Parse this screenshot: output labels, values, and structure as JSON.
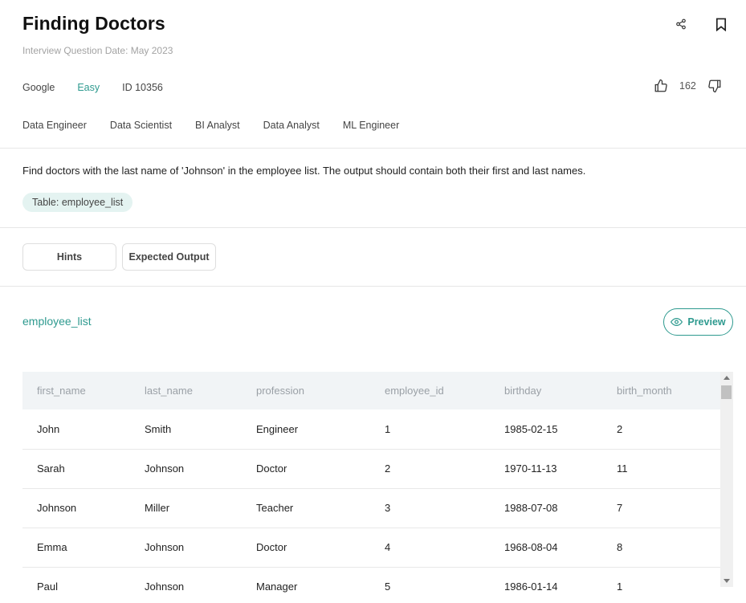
{
  "question": {
    "title": "Finding Doctors",
    "date": "Interview Question Date: May 2023",
    "company": "Google",
    "difficulty": "Easy",
    "id": "ID 10356",
    "votes": "162",
    "roles": [
      "Data Engineer",
      "Data Scientist",
      "BI Analyst",
      "Data Analyst",
      "ML Engineer"
    ],
    "description": "Find doctors with the last name of 'Johnson' in the employee list. The output should contain both their first and last names.",
    "table_chip": "Table: employee_list"
  },
  "tabs": {
    "hints": "Hints",
    "expected": "Expected Output"
  },
  "table": {
    "name": "employee_list",
    "preview_label": "Preview",
    "columns": [
      "first_name",
      "last_name",
      "profession",
      "employee_id",
      "birthday",
      "birth_month"
    ],
    "rows": [
      [
        "John",
        "Smith",
        "Engineer",
        "1",
        "1985-02-15",
        "2"
      ],
      [
        "Sarah",
        "Johnson",
        "Doctor",
        "2",
        "1970-11-13",
        "11"
      ],
      [
        "Johnson",
        "Miller",
        "Teacher",
        "3",
        "1988-07-08",
        "7"
      ],
      [
        "Emma",
        "Johnson",
        "Doctor",
        "4",
        "1968-08-04",
        "8"
      ],
      [
        "Paul",
        "Johnson",
        "Manager",
        "5",
        "1986-01-14",
        "1"
      ]
    ]
  },
  "colors": {
    "accent": "#2e9a8f",
    "chip_bg": "#e4f3f1",
    "header_bg": "#f1f4f6"
  },
  "icons": [
    "share-icon",
    "bookmark-icon",
    "thumbs-up-icon",
    "thumbs-down-icon",
    "eye-icon"
  ]
}
